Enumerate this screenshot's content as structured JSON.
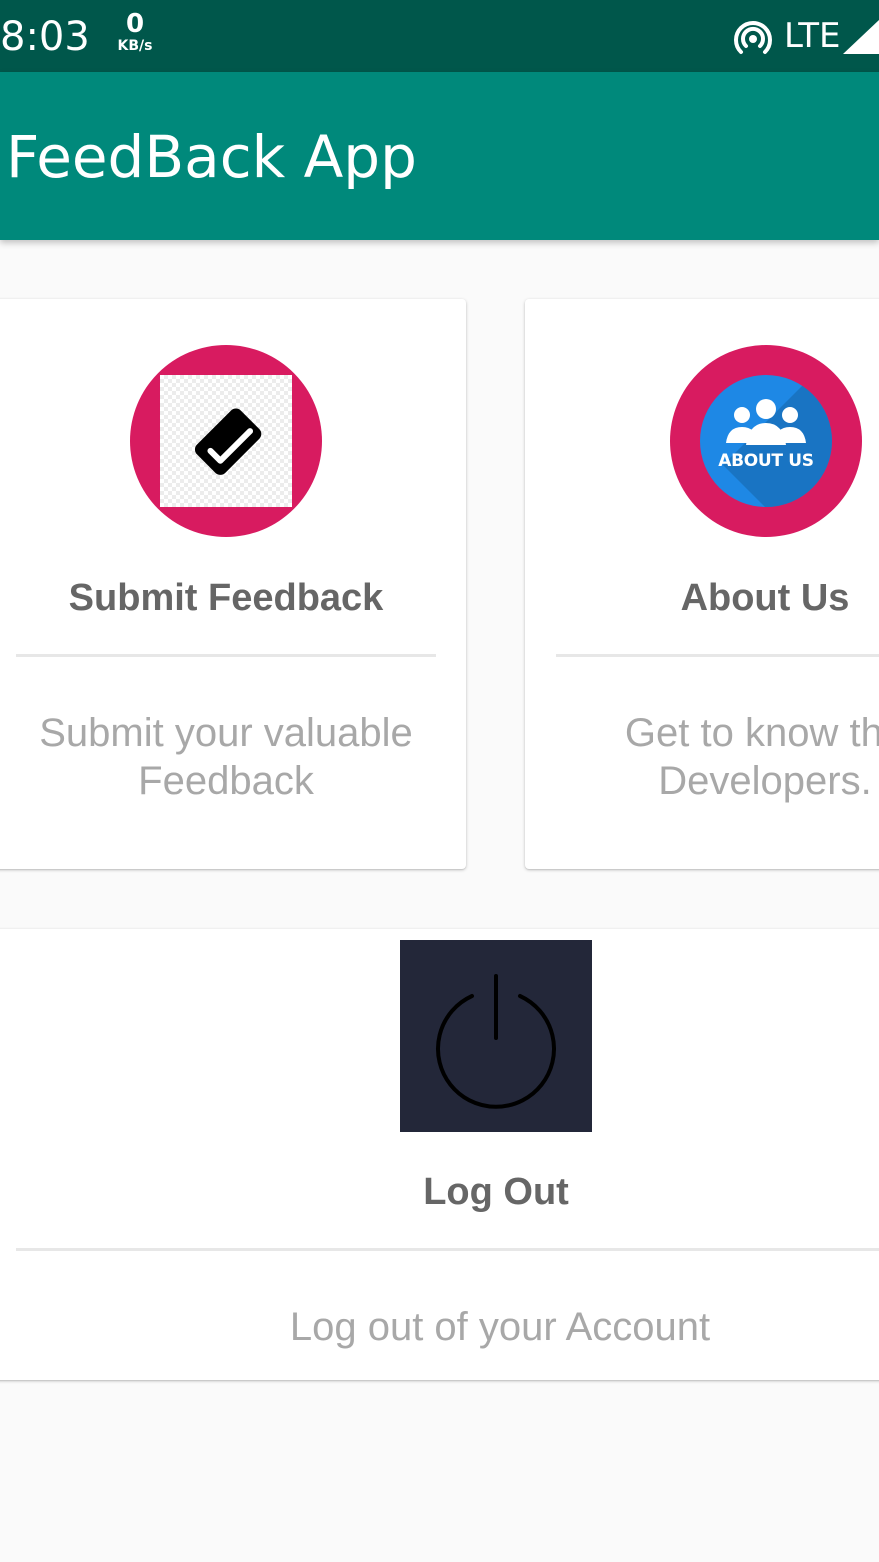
{
  "status_bar": {
    "time": "8:03",
    "speed_value": "0",
    "speed_unit": "KB/s",
    "network": "LTE"
  },
  "app_bar": {
    "title": "FeedBack App"
  },
  "cards": {
    "feedback": {
      "title": "Submit Feedback",
      "description_line1": "Submit your valuable",
      "description_line2": "Feedback",
      "icon": "check-badge-icon"
    },
    "about": {
      "title": "About Us",
      "description_line1": "Get to know the",
      "description_line2": "Developers.",
      "badge_text": "ABOUT US",
      "icon": "team-icon"
    },
    "logout": {
      "title": "Log Out",
      "description": "Log out of your Account",
      "icon": "power-icon"
    }
  },
  "colors": {
    "status_bar": "#00574b",
    "app_bar": "#00897b",
    "accent": "#d81b60",
    "about_blue": "#1e88e5",
    "power_bg": "#232739"
  }
}
